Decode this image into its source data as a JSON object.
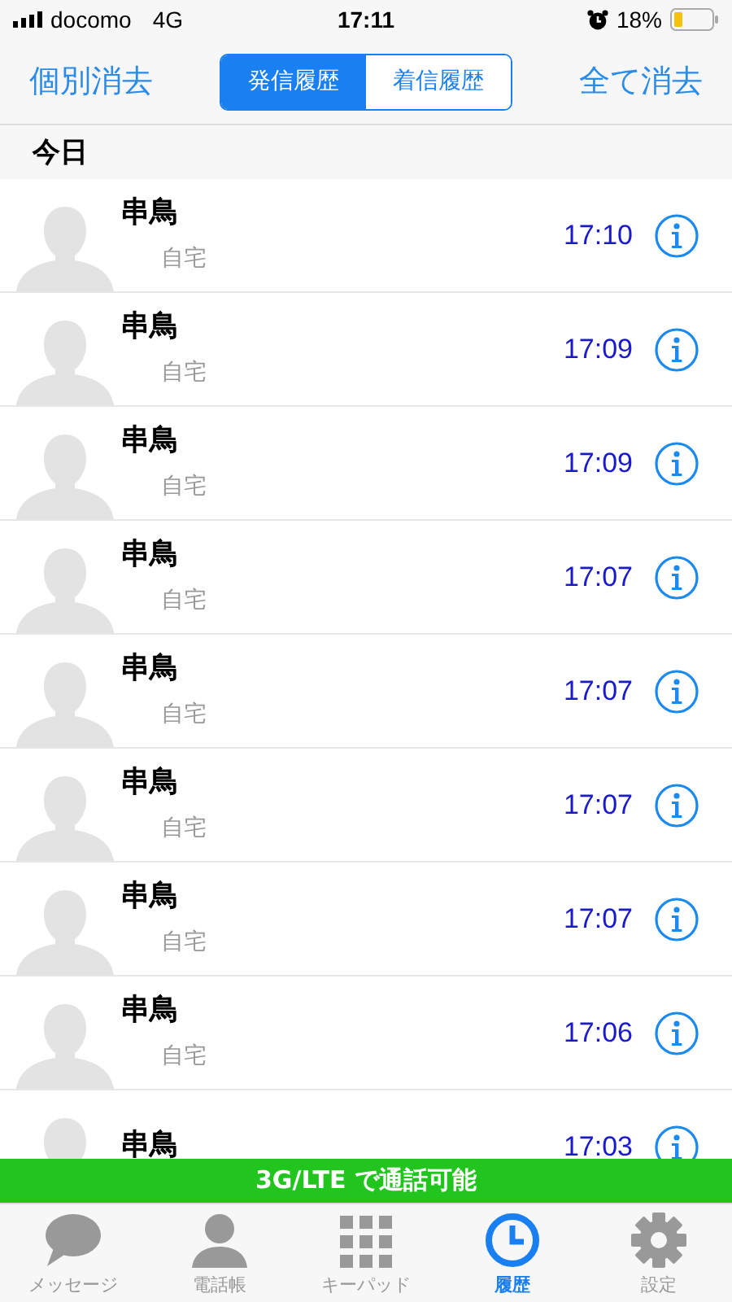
{
  "status_bar": {
    "carrier": "docomo",
    "network": "4G",
    "time": "17:11",
    "battery": "18%"
  },
  "nav": {
    "left_button": "個別消去",
    "right_button": "全て消去",
    "segments": [
      {
        "label": "発信履歴",
        "selected": true
      },
      {
        "label": "着信履歴",
        "selected": false
      }
    ]
  },
  "section": "今日",
  "calls": [
    {
      "name": "串鳥",
      "type": "自宅",
      "time": "17:10"
    },
    {
      "name": "串鳥",
      "type": "自宅",
      "time": "17:09"
    },
    {
      "name": "串鳥",
      "type": "自宅",
      "time": "17:09"
    },
    {
      "name": "串鳥",
      "type": "自宅",
      "time": "17:07"
    },
    {
      "name": "串鳥",
      "type": "自宅",
      "time": "17:07"
    },
    {
      "name": "串鳥",
      "type": "自宅",
      "time": "17:07"
    },
    {
      "name": "串鳥",
      "type": "自宅",
      "time": "17:07"
    },
    {
      "name": "串鳥",
      "type": "自宅",
      "time": "17:06"
    },
    {
      "name": "串鳥",
      "time": "17:03"
    }
  ],
  "banner": "3G/LTE で通話可能",
  "tab_bar": [
    {
      "kind": "messages",
      "label": "メッセージ",
      "selected": false
    },
    {
      "kind": "contacts",
      "label": "電話帳",
      "selected": false
    },
    {
      "kind": "keypad",
      "label": "キーパッド",
      "selected": false
    },
    {
      "kind": "history",
      "label": "履歴",
      "selected": true
    },
    {
      "kind": "settings",
      "label": "設定",
      "selected": false
    }
  ]
}
